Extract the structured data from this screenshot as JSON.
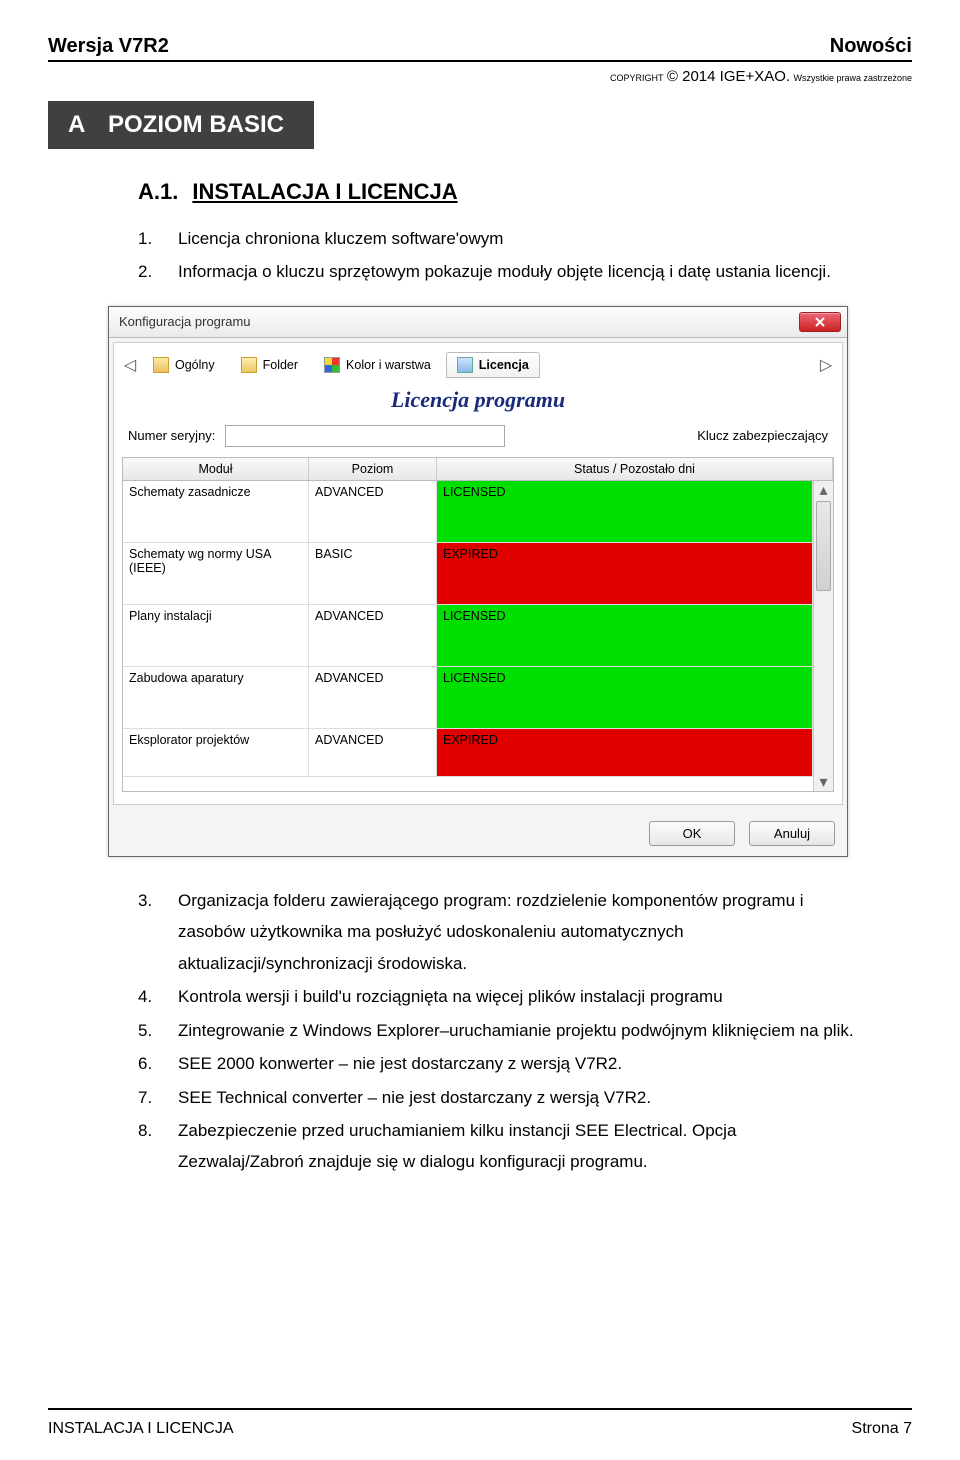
{
  "header": {
    "version": "Wersja V7R2",
    "right": "Nowości"
  },
  "copyright": {
    "pre": "COPYRIGHT",
    "year": "© 2014 IGE+XAO.",
    "tail": "Wszystkie prawa zastrzeżone"
  },
  "sectionA": {
    "letter": "A",
    "title": "POZIOM BASIC"
  },
  "heading": {
    "num": "A.1.",
    "text": "INSTALACJA I LICENCJA"
  },
  "list_top": [
    "Licencja chroniona kluczem software'owym",
    "Informacja o kluczu sprzętowym pokazuje moduły objęte licencją i datę ustania licencji."
  ],
  "dialog": {
    "title": "Konfiguracja programu",
    "tabs": [
      "Ogólny",
      "Folder",
      "Kolor i warstwa",
      "Licencja"
    ],
    "active_tab_index": 3,
    "lic_heading": "Licencja programu",
    "serial_label": "Numer seryjny:",
    "serial_value": "",
    "serial_side": "Klucz zabezpieczający",
    "headers": [
      "Moduł",
      "Poziom",
      "Status / Pozostało dni"
    ],
    "rows": [
      {
        "mod": "Schematy zasadnicze",
        "poz": "ADVANCED",
        "stat": "LICENSED",
        "color": "green"
      },
      {
        "mod": "Schematy wg normy USA (IEEE)",
        "poz": "BASIC",
        "stat": "EXPIRED",
        "color": "red"
      },
      {
        "mod": "Plany instalacji",
        "poz": "ADVANCED",
        "stat": "LICENSED",
        "color": "green"
      },
      {
        "mod": "Zabudowa aparatury",
        "poz": "ADVANCED",
        "stat": "LICENSED",
        "color": "green"
      },
      {
        "mod": "Eksplorator projektów",
        "poz": "ADVANCED",
        "stat": "EXPIRED",
        "color": "red"
      }
    ],
    "ok": "OK",
    "cancel": "Anuluj"
  },
  "list_bottom": [
    "Organizacja folderu zawierającego program: rozdzielenie komponentów programu i zasobów użytkownika ma posłużyć udoskonaleniu automatycznych aktualizacji/synchronizacji środowiska.",
    "Kontrola wersji i build'u rozciągnięta na więcej plików instalacji programu",
    "Zintegrowanie z Windows Explorer–uruchamianie projektu podwójnym kliknięciem na plik.",
    "SEE 2000 konwerter     – nie jest dostarczany z wersją V7R2.",
    "SEE Technical converter – nie jest dostarczany z wersją V7R2.",
    "Zabezpieczenie przed uruchamianiem kilku instancji SEE Electrical. Opcja Zezwalaj/Zabroń znajduje się w dialogu konfiguracji programu."
  ],
  "footer": {
    "left": "INSTALACJA I LICENCJA",
    "right": "Strona 7"
  }
}
